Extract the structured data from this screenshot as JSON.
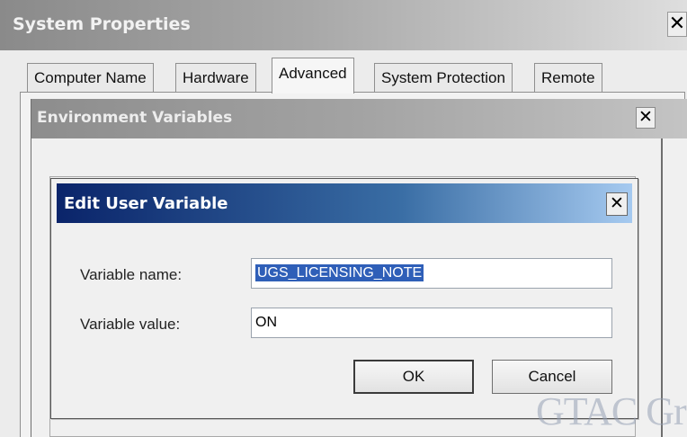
{
  "system_properties": {
    "title": "System Properties",
    "close_glyph": "✕",
    "tabs": [
      {
        "label": "Computer Name",
        "active": false
      },
      {
        "label": "Hardware",
        "active": false
      },
      {
        "label": "Advanced",
        "active": true
      },
      {
        "label": "System Protection",
        "active": false
      },
      {
        "label": "Remote",
        "active": false
      }
    ]
  },
  "environment_variables": {
    "title": "Environment Variables",
    "close_glyph": "✕"
  },
  "edit_user_variable": {
    "title": "Edit User Variable",
    "close_glyph": "✕",
    "name_label": "Variable name:",
    "name_value": "UGS_LICENSING_NOTE",
    "value_label": "Variable value:",
    "value_value": "ON",
    "ok_label": "OK",
    "cancel_label": "Cancel"
  },
  "watermark": "GTAC Gro",
  "colors": {
    "dialog_title_start": "#0a246a",
    "dialog_title_end": "#a6caf0",
    "selection": "#2f5fb8"
  }
}
